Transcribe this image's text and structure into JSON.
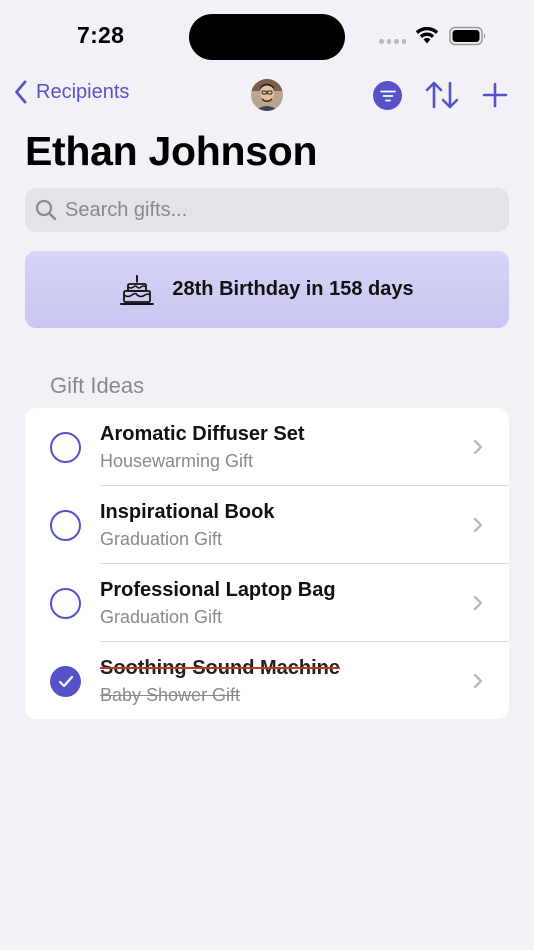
{
  "status_bar": {
    "time": "7:28"
  },
  "nav": {
    "back_label": "Recipients"
  },
  "recipient": {
    "name": "Ethan Johnson"
  },
  "search": {
    "placeholder": "Search gifts..."
  },
  "banner": {
    "text": "28th Birthday in 158 days"
  },
  "section": {
    "title": "Gift Ideas"
  },
  "gifts": [
    {
      "name": "Aromatic Diffuser Set",
      "occasion": "Housewarming Gift",
      "done": false
    },
    {
      "name": "Inspirational Book",
      "occasion": "Graduation Gift",
      "done": false
    },
    {
      "name": "Professional Laptop Bag",
      "occasion": "Graduation Gift",
      "done": false
    },
    {
      "name": "Soothing Sound Machine",
      "occasion": "Baby Shower Gift",
      "done": true
    }
  ],
  "colors": {
    "accent": "#5553c7",
    "background": "#f2f1f7",
    "banner": "#d3d1f5",
    "secondary_text": "#8a898f"
  },
  "icons": [
    "chevron-left-icon",
    "filter-icon",
    "sort-icon",
    "plus-icon",
    "search-icon",
    "birthday-cake-icon",
    "checkmark-icon",
    "chevron-right-icon",
    "wifi-icon",
    "battery-icon"
  ]
}
